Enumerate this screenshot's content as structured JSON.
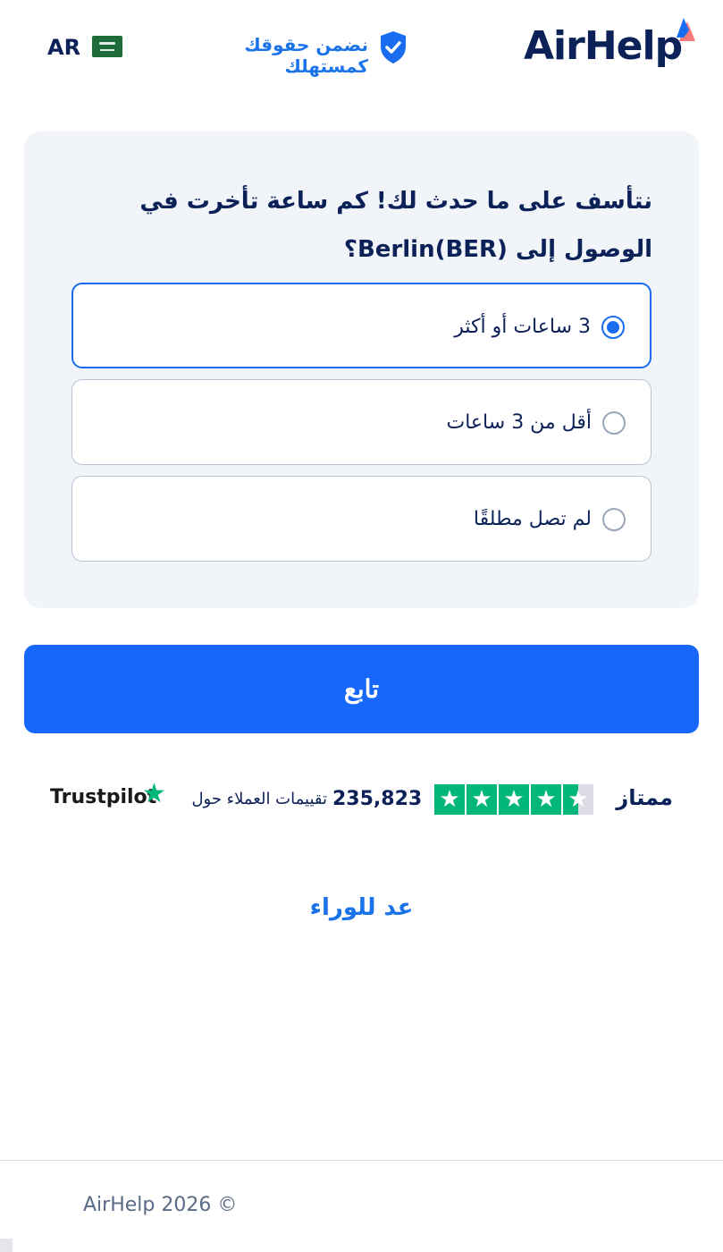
{
  "header": {
    "logo_text": "AirHelp",
    "guarantee_text": "نضمن حقوقك كمستهلك",
    "language_code": "AR",
    "brand_color": "#0b2158",
    "accent_color": "#1a73e8"
  },
  "question": {
    "text": "نتأسف على ما حدث لك! كم ساعة تأخرت في الوصول إلى Berlin(BER)؟",
    "options": [
      {
        "label": "3 ساعات أو أكثر",
        "selected": true
      },
      {
        "label": "أقل من 3 ساعات",
        "selected": false
      },
      {
        "label": "لم تصل مطلقًا",
        "selected": false
      }
    ]
  },
  "continue_button": {
    "label": "تابع",
    "color": "#1768fa"
  },
  "trustpilot": {
    "rating_word": "ممتاز",
    "stars": 4.5,
    "review_count": "235,823",
    "reviews_text": "تقييمات العملاء حول",
    "brand": "Trustpilot",
    "star_color": "#00b67a"
  },
  "back_link": {
    "label": "عد للوراء"
  },
  "footer": {
    "copyright": "AirHelp 2026 ©"
  }
}
